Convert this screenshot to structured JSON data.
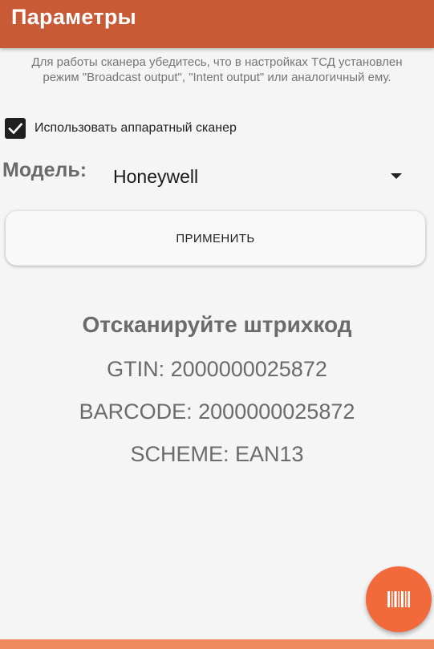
{
  "app_bar": {
    "title": "Параметры"
  },
  "settings": {
    "hint_text": "Для работы сканера убедитесь, что в настройках ТСД установлен режим \"Broadcast output\", \"Intent output\" или аналогичный ему.",
    "use_hardware_scanner_label": "Использовать аппаратный сканер",
    "use_hardware_scanner_checked": true,
    "model_label": "Модель:",
    "model_value": "Honeywell",
    "apply_label": "ПРИМЕНИТЬ"
  },
  "scan_result": {
    "prompt": "Отсканируйте штрихкод",
    "gtin": "GTIN: 2000000025872",
    "barcode": "BARCODE: 2000000025872",
    "scheme": "SCHEME: EAN13"
  },
  "fab": {
    "icon": "barcode-icon"
  },
  "colors": {
    "app_bar": "#c85a36",
    "fab": "#f26a3c",
    "bottom_strip": "#f08a5c",
    "background": "#f5f5f5"
  }
}
